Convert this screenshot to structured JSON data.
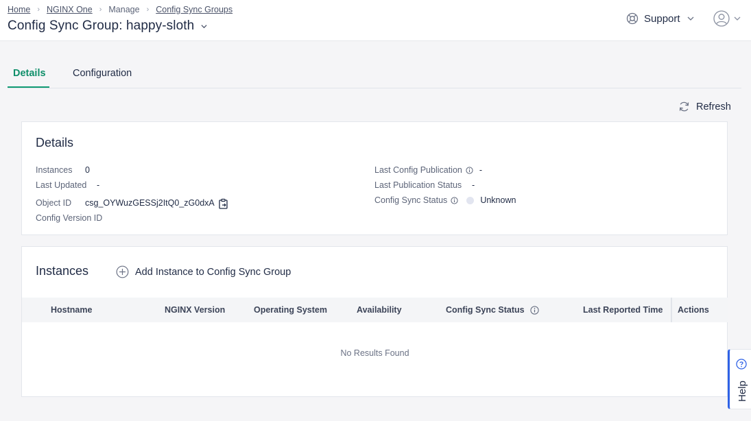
{
  "breadcrumb": {
    "home": "Home",
    "nginx_one": "NGINX One",
    "manage": "Manage",
    "config_sync_groups": "Config Sync Groups"
  },
  "title": "Config Sync Group: happy-sloth",
  "support_label": "Support",
  "tabs": [
    {
      "label": "Details",
      "active": true
    },
    {
      "label": "Configuration",
      "active": false
    }
  ],
  "refresh_label": "Refresh",
  "details": {
    "title": "Details",
    "instances_label": "Instances",
    "instances_value": "0",
    "last_updated_label": "Last Updated",
    "last_updated_value": "-",
    "object_id_label": "Object ID",
    "object_id_value": "csg_OYWuzGESSj2ItQ0_zG0dxA",
    "config_version_label": "Config Version ID",
    "last_config_publication_label": "Last Config Publication",
    "last_config_publication_value": "-",
    "last_publication_status_label": "Last Publication Status",
    "last_publication_status_value": "-",
    "config_sync_status_label": "Config Sync Status",
    "config_sync_status_value": "Unknown"
  },
  "instances": {
    "title": "Instances",
    "add_label": "Add Instance to Config Sync Group",
    "columns": [
      "Hostname",
      "NGINX Version",
      "Operating System",
      "Availability",
      "Config Sync Status",
      "Last Reported Time",
      "Actions"
    ],
    "empty_text": "No Results Found"
  },
  "help_label": "Help",
  "colors": {
    "accent": "#0f9a72",
    "help_border": "#2f62e6",
    "text": "#1f2a44"
  }
}
